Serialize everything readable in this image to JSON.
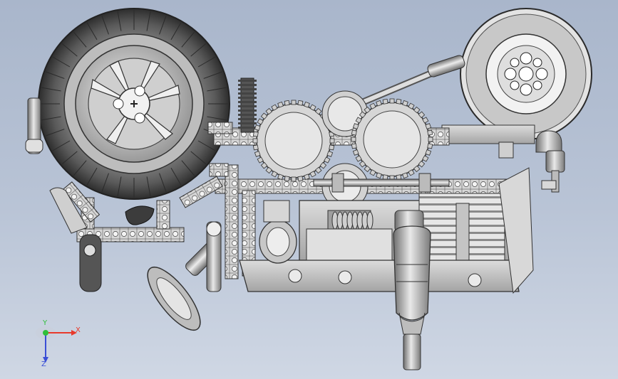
{
  "viewport": {
    "background_top": "#a9b6cb",
    "background_bottom": "#cfd7e4"
  },
  "model": {
    "description_icon": "lego-technic-assembly"
  },
  "triad": {
    "x_label": "X",
    "y_label": "Y",
    "z_label": "Z",
    "x_color": "#e8392b",
    "y_color": "#2fbf3a",
    "z_color": "#3a4fd6"
  }
}
